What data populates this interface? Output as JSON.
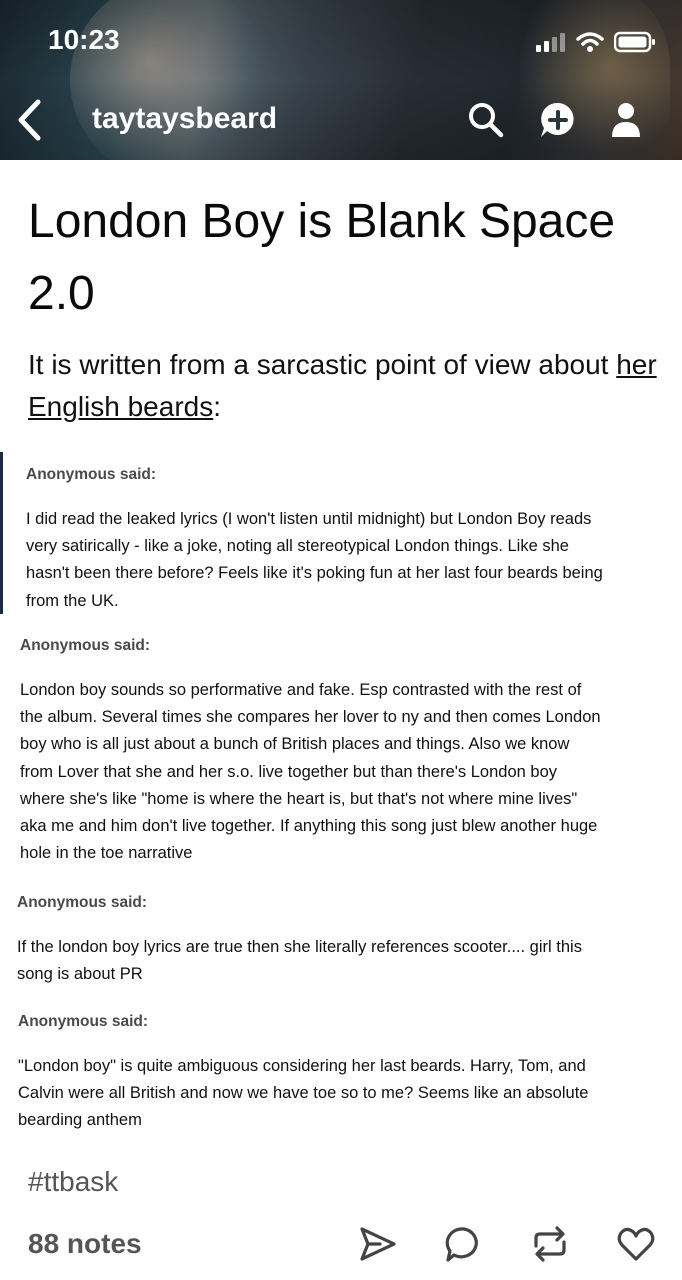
{
  "status_bar": {
    "time": "10:23"
  },
  "header": {
    "blog_name": "taytaysbeard",
    "icons": [
      "back-icon",
      "search-icon",
      "compose-icon",
      "account-icon"
    ]
  },
  "post": {
    "title": "London Boy is Blank Space 2.0",
    "intro_text": "It is written from a sarcastic point of view about ",
    "intro_link": "her English beards",
    "intro_end": ":",
    "asks": [
      {
        "said": "Anonymous said:",
        "lines": [
          "I did read the leaked lyrics (I won't listen until midnight) but London Boy reads",
          "very satirically - like a joke, noting all stereotypical London things. Like she",
          "hasn't been there before? Feels like it's poking fun at her last four beards being",
          "from the UK."
        ]
      },
      {
        "said": "Anonymous said:",
        "lines": [
          "London boy sounds so performative and fake. Esp contrasted with the rest of",
          "the album. Several times she compares her lover to ny and then comes London",
          "boy who is all just about a bunch of British places and things. Also we know",
          "from Lover that she and her s.o. live together but than there's London boy",
          "where she's like \"home is where the heart is, but that's not where mine lives\"",
          "aka me and him don't live together. If anything this song just blew another huge",
          "hole in the toe narrative"
        ]
      },
      {
        "said": "Anonymous said:",
        "lines": [
          "If the london boy lyrics are true then she literally references scooter.... girl this",
          "song is about PR"
        ]
      },
      {
        "said": "Anonymous said:",
        "lines": [
          "\"London boy\" is quite ambiguous considering her last beards. Harry, Tom, and",
          "Calvin were all British and now we have toe so to me? Seems like an absolute",
          "bearding anthem"
        ]
      }
    ],
    "tag": "#ttbask",
    "notes": "88 notes"
  },
  "actions": [
    "share-icon",
    "reply-icon",
    "reblog-icon",
    "like-icon"
  ],
  "colors": {
    "header_accent": "#2f4b57",
    "quote_bar": "#1b2a44",
    "muted_text": "#555555"
  }
}
